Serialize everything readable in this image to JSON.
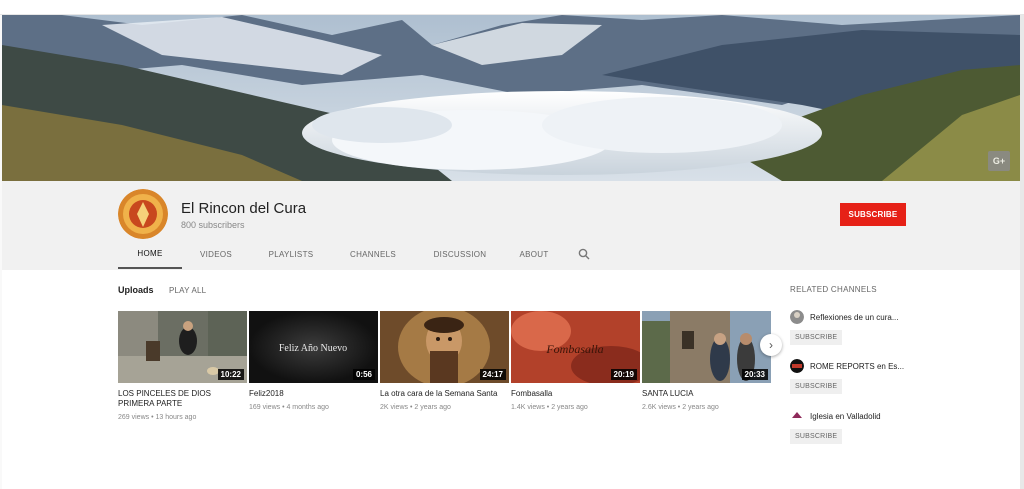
{
  "channel": {
    "name": "El Rincon del Cura",
    "subscribers": "800 subscribers",
    "subscribe_label": "SUBSCRIBE",
    "gplus_label": "G+"
  },
  "tabs": [
    {
      "label": "HOME",
      "active": true
    },
    {
      "label": "VIDEOS",
      "active": false
    },
    {
      "label": "PLAYLISTS",
      "active": false
    },
    {
      "label": "CHANNELS",
      "active": false
    },
    {
      "label": "DISCUSSION",
      "active": false
    },
    {
      "label": "ABOUT",
      "active": false
    }
  ],
  "uploads": {
    "title": "Uploads",
    "play_all": "PLAY ALL",
    "videos": [
      {
        "title": "LOS PINCELES DE DIOS PRIMERA PARTE",
        "duration": "10:22",
        "meta": "269 views • 13 hours ago"
      },
      {
        "title": "Feliz2018",
        "duration": "0:56",
        "meta": "169 views • 4 months ago",
        "overlay": "Feliz Año Nuevo"
      },
      {
        "title": "La otra cara de la Semana Santa",
        "duration": "24:17",
        "meta": "2K views • 2 years ago"
      },
      {
        "title": "Fombasalla",
        "duration": "20:19",
        "meta": "1.4K views • 2 years ago",
        "overlay": "Fombasalla"
      },
      {
        "title": "SANTA LUCIA",
        "duration": "20:33",
        "meta": "2.6K views • 2 years ago"
      }
    ]
  },
  "related": {
    "title": "RELATED CHANNELS",
    "channels": [
      {
        "name": "Reflexiones de un cura...",
        "subscribe_label": "SUBSCRIBE"
      },
      {
        "name": "ROME REPORTS en Es...",
        "subscribe_label": "SUBSCRIBE"
      },
      {
        "name": "Iglesia en Valladolid",
        "subscribe_label": "SUBSCRIBE"
      }
    ]
  },
  "colors": {
    "subscribe_red": "#e62117",
    "header_bg": "#f1f1f1",
    "page_bg": "#ffffff"
  },
  "icons": {
    "search": "search-icon",
    "next": "chevron-right-icon",
    "gplus": "google-plus-icon"
  }
}
